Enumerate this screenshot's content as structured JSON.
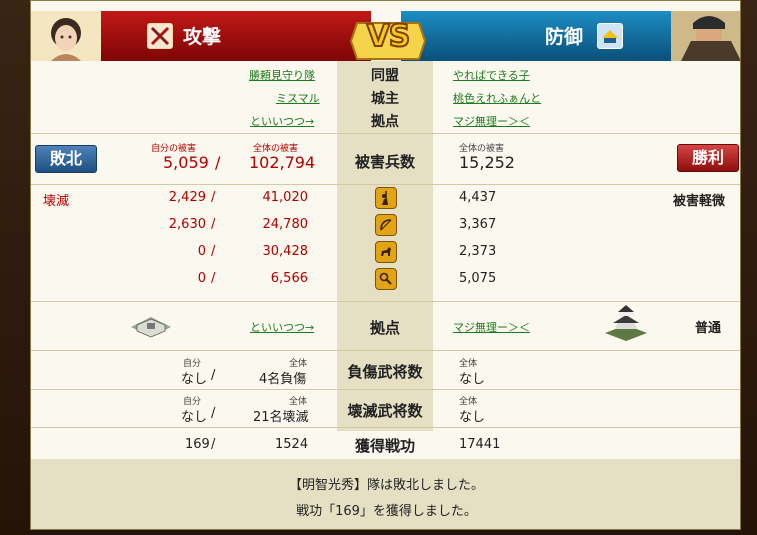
{
  "header": {
    "attack_label": "攻撃",
    "defense_label": "防御",
    "vs_text": "VS",
    "attack_portrait_icon": "female-portrait-icon",
    "defense_portrait_icon": "male-warrior-portrait-icon",
    "attack_unit_icon": "crossed-swords-icon",
    "defense_unit_icon": "castle-shield-icon"
  },
  "info": {
    "alliance_label": "同盟",
    "lord_label": "城主",
    "base_label": "拠点",
    "attacker_alliance": "勝頼見守り隊",
    "attacker_lord": "ミスマル",
    "attacker_base": "といいつつ→",
    "defender_alliance": "やればできる子",
    "defender_lord": "桃色えれふぁんと",
    "defender_base": "マジ無理ー＞＜"
  },
  "casualties": {
    "label": "被害兵数",
    "attacker_result": "敗北",
    "defender_result": "勝利",
    "own_damage_label": "自分の被害",
    "total_damage_label": "全体の被害",
    "defender_total_label": "全体の被害",
    "attacker_own": "5,059",
    "attacker_slash": "/",
    "attacker_total": "102,794",
    "defender_total": "15,252"
  },
  "units": {
    "attacker_status": "壊滅",
    "defender_status": "被害軽微",
    "rows": [
      {
        "icon": "spearman-icon",
        "own": "2,429",
        "total": "41,020",
        "defender": "4,437"
      },
      {
        "icon": "archer-bow-icon",
        "own": "2,630",
        "total": "24,780",
        "defender": "3,367"
      },
      {
        "icon": "cavalry-horse-icon",
        "own": "0",
        "total": "30,428",
        "defender": "2,373"
      },
      {
        "icon": "siege-weapon-icon",
        "own": "0",
        "total": "6,566",
        "defender": "5,075"
      }
    ]
  },
  "base_row": {
    "label": "拠点",
    "attacker_base": "といいつつ→",
    "defender_base": "マジ無理ー＞＜",
    "defender_state": "普通",
    "attacker_castle_icon": "fort-icon",
    "defender_castle_icon": "japanese-castle-icon"
  },
  "generals_wounded": {
    "label": "負傷武将数",
    "self_label": "自分",
    "total_label": "全体",
    "attacker_self": "なし",
    "attacker_total": "4名負傷",
    "defender_total_label": "全体",
    "defender_total": "なし"
  },
  "generals_destroyed": {
    "label": "壊滅武将数",
    "self_label": "自分",
    "total_label": "全体",
    "attacker_self": "なし",
    "attacker_total": "21名壊滅",
    "defender_total_label": "全体",
    "defender_total": "なし"
  },
  "merit": {
    "label": "獲得戦功",
    "attacker_self": "169",
    "attacker_total": "1524",
    "defender_total": "17441"
  },
  "messages": {
    "line1": "【明智光秀】隊は敗北しました。",
    "line2": "戦功「169」を獲得しました。"
  }
}
